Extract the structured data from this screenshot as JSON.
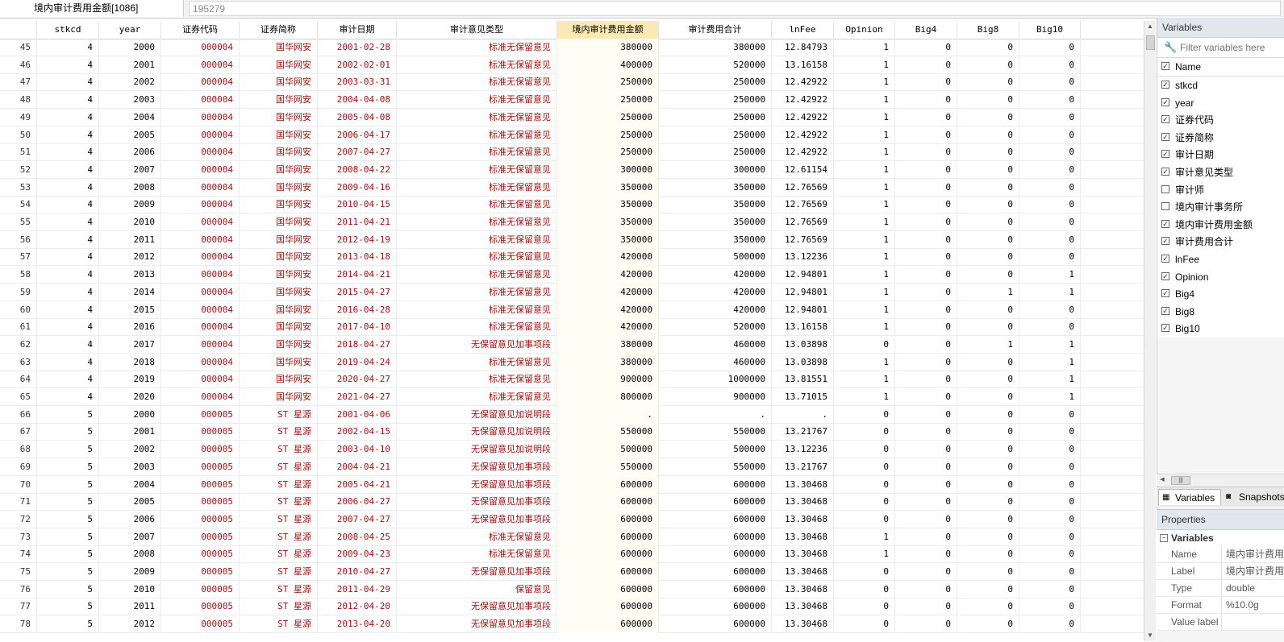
{
  "toolbar": {
    "variable_name": "境内审计费用金额[1086]",
    "cell_value": "195279"
  },
  "grid": {
    "columns": [
      "stkcd",
      "year",
      "证券代码",
      "证券简称",
      "审计日期",
      "审计意见类型",
      "境内审计费用金额",
      "审计费用合计",
      "lnFee",
      "Opinion",
      "Big4",
      "Big8",
      "Big10"
    ],
    "selected_column": "境内审计费用金额",
    "rows": [
      [
        "45",
        "4",
        "2000",
        "000004",
        "国华网安",
        "2001-02-28",
        "标准无保留意见",
        "380000",
        "380000",
        "12.84793",
        "1",
        "0",
        "0",
        "0"
      ],
      [
        "46",
        "4",
        "2001",
        "000004",
        "国华网安",
        "2002-02-01",
        "标准无保留意见",
        "400000",
        "520000",
        "13.16158",
        "1",
        "0",
        "0",
        "0"
      ],
      [
        "47",
        "4",
        "2002",
        "000004",
        "国华网安",
        "2003-03-31",
        "标准无保留意见",
        "250000",
        "250000",
        "12.42922",
        "1",
        "0",
        "0",
        "0"
      ],
      [
        "48",
        "4",
        "2003",
        "000004",
        "国华网安",
        "2004-04-08",
        "标准无保留意见",
        "250000",
        "250000",
        "12.42922",
        "1",
        "0",
        "0",
        "0"
      ],
      [
        "49",
        "4",
        "2004",
        "000004",
        "国华网安",
        "2005-04-08",
        "标准无保留意见",
        "250000",
        "250000",
        "12.42922",
        "1",
        "0",
        "0",
        "0"
      ],
      [
        "50",
        "4",
        "2005",
        "000004",
        "国华网安",
        "2006-04-17",
        "标准无保留意见",
        "250000",
        "250000",
        "12.42922",
        "1",
        "0",
        "0",
        "0"
      ],
      [
        "51",
        "4",
        "2006",
        "000004",
        "国华网安",
        "2007-04-27",
        "标准无保留意见",
        "250000",
        "250000",
        "12.42922",
        "1",
        "0",
        "0",
        "0"
      ],
      [
        "52",
        "4",
        "2007",
        "000004",
        "国华网安",
        "2008-04-22",
        "标准无保留意见",
        "300000",
        "300000",
        "12.61154",
        "1",
        "0",
        "0",
        "0"
      ],
      [
        "53",
        "4",
        "2008",
        "000004",
        "国华网安",
        "2009-04-16",
        "标准无保留意见",
        "350000",
        "350000",
        "12.76569",
        "1",
        "0",
        "0",
        "0"
      ],
      [
        "54",
        "4",
        "2009",
        "000004",
        "国华网安",
        "2010-04-15",
        "标准无保留意见",
        "350000",
        "350000",
        "12.76569",
        "1",
        "0",
        "0",
        "0"
      ],
      [
        "55",
        "4",
        "2010",
        "000004",
        "国华网安",
        "2011-04-21",
        "标准无保留意见",
        "350000",
        "350000",
        "12.76569",
        "1",
        "0",
        "0",
        "0"
      ],
      [
        "56",
        "4",
        "2011",
        "000004",
        "国华网安",
        "2012-04-19",
        "标准无保留意见",
        "350000",
        "350000",
        "12.76569",
        "1",
        "0",
        "0",
        "0"
      ],
      [
        "57",
        "4",
        "2012",
        "000004",
        "国华网安",
        "2013-04-18",
        "标准无保留意见",
        "420000",
        "500000",
        "13.12236",
        "1",
        "0",
        "0",
        "0"
      ],
      [
        "58",
        "4",
        "2013",
        "000004",
        "国华网安",
        "2014-04-21",
        "标准无保留意见",
        "420000",
        "420000",
        "12.94801",
        "1",
        "0",
        "0",
        "1"
      ],
      [
        "59",
        "4",
        "2014",
        "000004",
        "国华网安",
        "2015-04-27",
        "标准无保留意见",
        "420000",
        "420000",
        "12.94801",
        "1",
        "0",
        "1",
        "1"
      ],
      [
        "60",
        "4",
        "2015",
        "000004",
        "国华网安",
        "2016-04-28",
        "标准无保留意见",
        "420000",
        "420000",
        "12.94801",
        "1",
        "0",
        "0",
        "0"
      ],
      [
        "61",
        "4",
        "2016",
        "000004",
        "国华网安",
        "2017-04-10",
        "标准无保留意见",
        "420000",
        "520000",
        "13.16158",
        "1",
        "0",
        "0",
        "0"
      ],
      [
        "62",
        "4",
        "2017",
        "000004",
        "国华网安",
        "2018-04-27",
        "无保留意见加事项段",
        "380000",
        "460000",
        "13.03898",
        "0",
        "0",
        "1",
        "1"
      ],
      [
        "63",
        "4",
        "2018",
        "000004",
        "国华网安",
        "2019-04-24",
        "标准无保留意见",
        "380000",
        "460000",
        "13.03898",
        "1",
        "0",
        "0",
        "1"
      ],
      [
        "64",
        "4",
        "2019",
        "000004",
        "国华网安",
        "2020-04-27",
        "标准无保留意见",
        "900000",
        "1000000",
        "13.81551",
        "1",
        "0",
        "0",
        "1"
      ],
      [
        "65",
        "4",
        "2020",
        "000004",
        "国华网安",
        "2021-04-27",
        "标准无保留意见",
        "800000",
        "900000",
        "13.71015",
        "1",
        "0",
        "0",
        "1"
      ],
      [
        "66",
        "5",
        "2000",
        "000005",
        "ST 星源",
        "2001-04-06",
        "无保留意见加说明段",
        ".",
        ".",
        ".",
        "0",
        "0",
        "0",
        "0"
      ],
      [
        "67",
        "5",
        "2001",
        "000005",
        "ST 星源",
        "2002-04-15",
        "无保留意见加说明段",
        "550000",
        "550000",
        "13.21767",
        "0",
        "0",
        "0",
        "0"
      ],
      [
        "68",
        "5",
        "2002",
        "000005",
        "ST 星源",
        "2003-04-10",
        "无保留意见加说明段",
        "500000",
        "500000",
        "13.12236",
        "0",
        "0",
        "0",
        "0"
      ],
      [
        "69",
        "5",
        "2003",
        "000005",
        "ST 星源",
        "2004-04-21",
        "无保留意见加事项段",
        "550000",
        "550000",
        "13.21767",
        "0",
        "0",
        "0",
        "0"
      ],
      [
        "70",
        "5",
        "2004",
        "000005",
        "ST 星源",
        "2005-04-21",
        "无保留意见加事项段",
        "600000",
        "600000",
        "13.30468",
        "0",
        "0",
        "0",
        "0"
      ],
      [
        "71",
        "5",
        "2005",
        "000005",
        "ST 星源",
        "2006-04-27",
        "无保留意见加事项段",
        "600000",
        "600000",
        "13.30468",
        "0",
        "0",
        "0",
        "0"
      ],
      [
        "72",
        "5",
        "2006",
        "000005",
        "ST 星源",
        "2007-04-27",
        "无保留意见加事项段",
        "600000",
        "600000",
        "13.30468",
        "0",
        "0",
        "0",
        "0"
      ],
      [
        "73",
        "5",
        "2007",
        "000005",
        "ST 星源",
        "2008-04-25",
        "标准无保留意见",
        "600000",
        "600000",
        "13.30468",
        "1",
        "0",
        "0",
        "0"
      ],
      [
        "74",
        "5",
        "2008",
        "000005",
        "ST 星源",
        "2009-04-23",
        "标准无保留意见",
        "600000",
        "600000",
        "13.30468",
        "1",
        "0",
        "0",
        "0"
      ],
      [
        "75",
        "5",
        "2009",
        "000005",
        "ST 星源",
        "2010-04-27",
        "无保留意见加事项段",
        "600000",
        "600000",
        "13.30468",
        "0",
        "0",
        "0",
        "0"
      ],
      [
        "76",
        "5",
        "2010",
        "000005",
        "ST 星源",
        "2011-04-29",
        "保留意见",
        "600000",
        "600000",
        "13.30468",
        "0",
        "0",
        "0",
        "0"
      ],
      [
        "77",
        "5",
        "2011",
        "000005",
        "ST 星源",
        "2012-04-20",
        "无保留意见加事项段",
        "600000",
        "600000",
        "13.30468",
        "0",
        "0",
        "0",
        "0"
      ],
      [
        "78",
        "5",
        "2012",
        "000005",
        "ST 星源",
        "2013-04-20",
        "无保留意见加事项段",
        "600000",
        "600000",
        "13.30468",
        "0",
        "0",
        "0",
        "0"
      ]
    ]
  },
  "variables_panel": {
    "title": "Variables",
    "filter_placeholder": "Filter variables here",
    "name_header": "Name",
    "items": [
      {
        "name": "stkcd",
        "checked": true
      },
      {
        "name": "year",
        "checked": true
      },
      {
        "name": "证券代码",
        "checked": true
      },
      {
        "name": "证券简称",
        "checked": true
      },
      {
        "name": "审计日期",
        "checked": true
      },
      {
        "name": "审计意见类型",
        "checked": true
      },
      {
        "name": "审计师",
        "checked": false
      },
      {
        "name": "境内审计事务所",
        "checked": false
      },
      {
        "name": "境内审计费用金额",
        "checked": true
      },
      {
        "name": "审计费用合计",
        "checked": true
      },
      {
        "name": "lnFee",
        "checked": true
      },
      {
        "name": "Opinion",
        "checked": true
      },
      {
        "name": "Big4",
        "checked": true
      },
      {
        "name": "Big8",
        "checked": true
      },
      {
        "name": "Big10",
        "checked": true
      }
    ],
    "hscroll_thumb": "|||",
    "tabs": [
      "Variables",
      "Snapshots"
    ]
  },
  "properties_panel": {
    "title": "Properties",
    "group": "Variables",
    "rows": [
      {
        "key": "Name",
        "value": "境内审计费用金额"
      },
      {
        "key": "Label",
        "value": "境内审计费用金额"
      },
      {
        "key": "Type",
        "value": "double"
      },
      {
        "key": "Format",
        "value": "%10.0g"
      },
      {
        "key": "Value label",
        "value": ""
      }
    ]
  },
  "colors": {
    "string_text": "#9c0f0f",
    "selected_header": "#fbe9b3",
    "panel_title": "#e2e6ed"
  }
}
